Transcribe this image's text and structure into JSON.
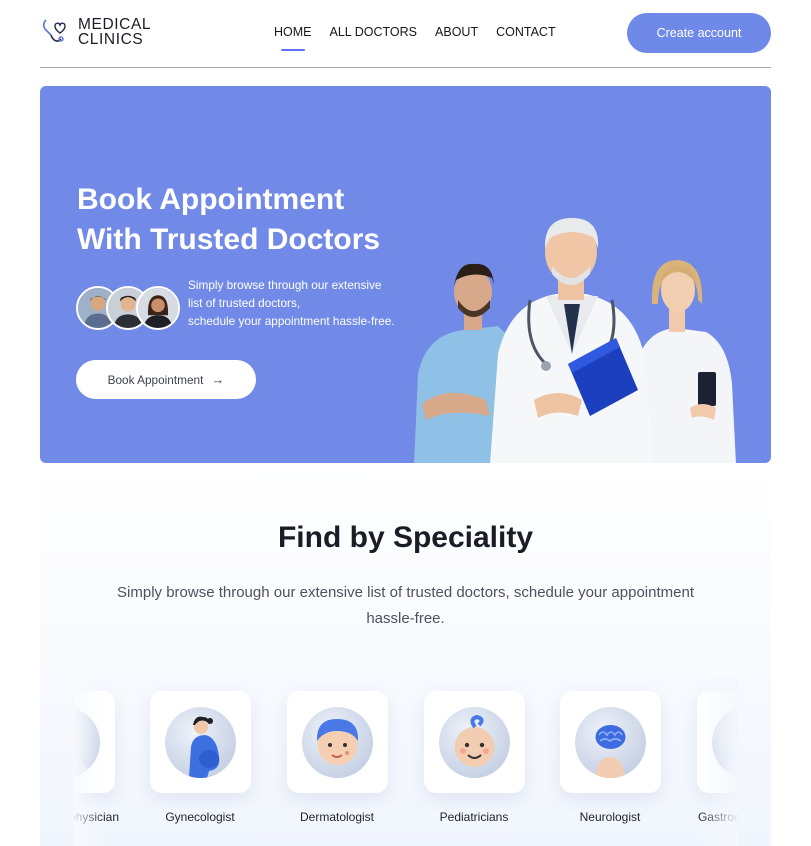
{
  "brand": {
    "line1": "MEDICAL",
    "line2": "CLINICS",
    "accent": "#5f6fff"
  },
  "nav": {
    "items": [
      {
        "label": "HOME",
        "active": true
      },
      {
        "label": "ALL DOCTORS"
      },
      {
        "label": "ABOUT"
      },
      {
        "label": "CONTACT"
      }
    ],
    "cta": "Create account"
  },
  "hero": {
    "title_line1": "Book Appointment",
    "title_line2": "With Trusted Doctors",
    "desc_line1": "Simply browse through our extensive list of trusted doctors,",
    "desc_line2": "schedule your appointment hassle-free.",
    "button": "Book Appointment",
    "button_icon": "arrow-right-icon",
    "background": "#7189e7"
  },
  "speciality": {
    "title": "Find by Speciality",
    "subtitle": "Simply browse through our extensive list of trusted doctors, schedule your appointment hassle-free.",
    "items": [
      {
        "label": "General physician",
        "icon": "general-physician-icon"
      },
      {
        "label": "Gynecologist",
        "icon": "gynecologist-icon"
      },
      {
        "label": "Dermatologist",
        "icon": "dermatologist-icon"
      },
      {
        "label": "Pediatricians",
        "icon": "pediatricians-icon"
      },
      {
        "label": "Neurologist",
        "icon": "neurologist-icon"
      },
      {
        "label": "Gastroenterologist",
        "icon": "gastroenterologist-icon"
      }
    ]
  }
}
